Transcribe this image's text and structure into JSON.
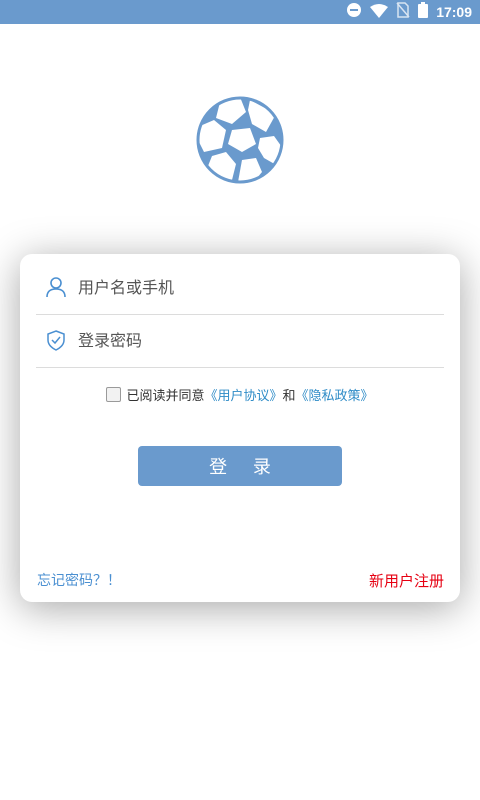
{
  "status_bar": {
    "time": "17:09",
    "icons": [
      "do-not-disturb-icon",
      "wifi-icon",
      "no-sim-icon",
      "battery-icon"
    ],
    "color": "#6a9acd"
  },
  "logo": {
    "icon": "soccer-ball-icon"
  },
  "login_form": {
    "username_placeholder": "用户名或手机",
    "password_placeholder": "登录密码",
    "agreement": {
      "checked": false,
      "prefix": "已阅读并同意",
      "user_agreement_link": "《用户协议》",
      "joiner": "和",
      "privacy_policy_link": "《隐私政策》"
    },
    "login_button": "登 录",
    "forgot_password": "忘记密码？！",
    "register": "新用户注册"
  },
  "colors": {
    "primary": "#6a9acd",
    "link": "#2f8cc7",
    "register": "#e60012"
  }
}
